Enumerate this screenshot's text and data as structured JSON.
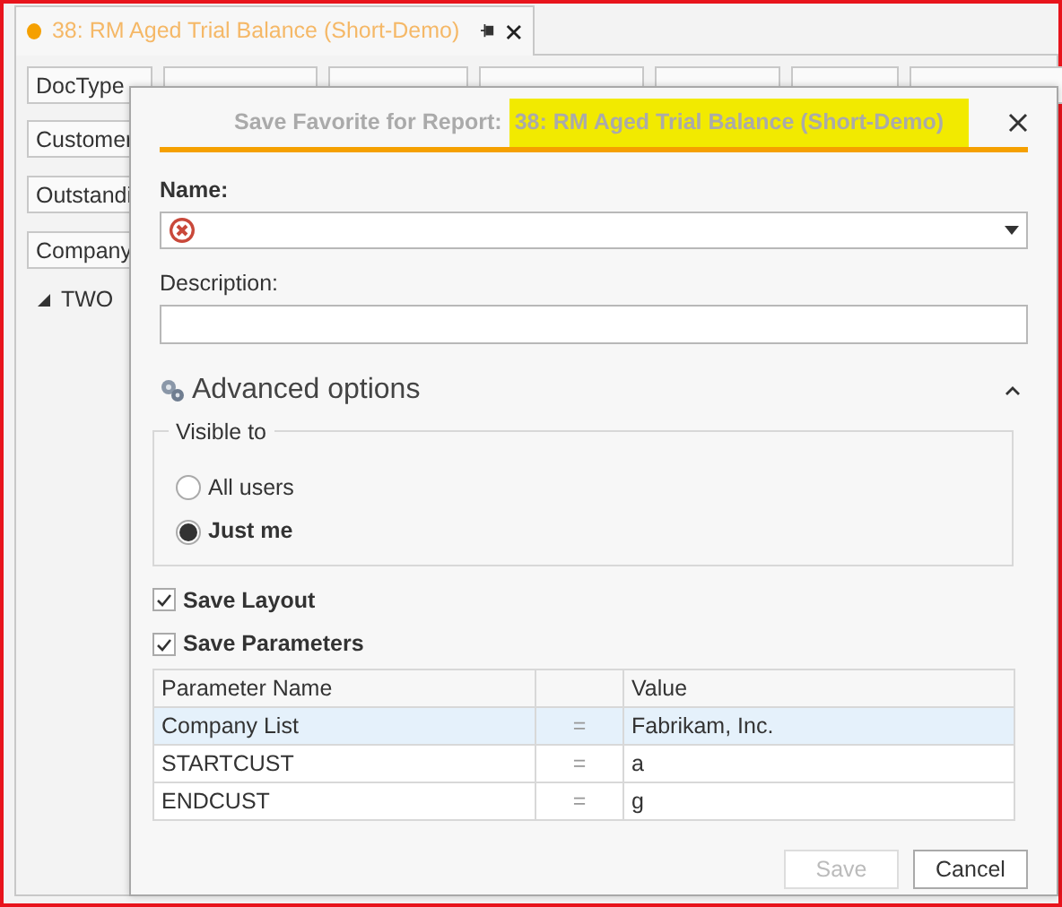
{
  "document_tab": {
    "title": "38: RM Aged Trial Balance (Short-Demo)",
    "selected": true
  },
  "field_tiles_top": [
    "DocType"
  ],
  "field_tiles_left": [
    "Customer",
    "Outstandi",
    "Company"
  ],
  "tree": [
    {
      "label": "TWO",
      "expanded": true
    }
  ],
  "dialog": {
    "title_prefix": "Save Favorite for Report:",
    "title_highlight": "38: RM Aged Trial Balance (Short-Demo)",
    "name_label": "Name:",
    "name_error": true,
    "description_label": "Description:",
    "advanced": {
      "label": "Advanced options",
      "expanded": true
    },
    "visible_to": {
      "legend": "Visible to",
      "options": [
        {
          "label": "All users",
          "selected": false
        },
        {
          "label": "Just me",
          "selected": true
        }
      ]
    },
    "checkboxes": [
      {
        "label": "Save Layout",
        "checked": true
      },
      {
        "label": "Save Parameters",
        "checked": true
      }
    ],
    "table": {
      "columns": [
        "Parameter Name",
        "Value"
      ],
      "rows": [
        {
          "name": "Company List",
          "operator": "=",
          "value": "Fabrikam, Inc.",
          "selected": true
        },
        {
          "name": "STARTCUST",
          "operator": "=",
          "value": "a",
          "selected": false
        },
        {
          "name": "ENDCUST",
          "operator": "=",
          "value": "g",
          "selected": false
        }
      ]
    },
    "buttons": [
      {
        "label": "Save",
        "disabled": true
      },
      {
        "label": "Cancel",
        "disabled": false
      }
    ]
  }
}
